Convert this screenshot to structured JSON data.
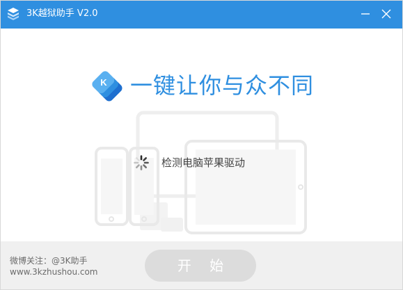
{
  "window": {
    "title": "3K越狱助手 V2.0",
    "accent_color": "#2f8fe0"
  },
  "titlebar": {
    "minimize_icon": "minimize-icon",
    "close_icon": "close-icon"
  },
  "main": {
    "logo_icon": "3k-logo-icon",
    "slogan": "一键让你与众不同",
    "status_text": "检测电脑苹果驱动",
    "spinner_icon": "loading-spinner-icon",
    "illustration": "devices-illustration"
  },
  "footer": {
    "weibo_text": "微博关注：@3K助手",
    "website_text": "www.3kzhushou.com",
    "start_button_label": "开 始"
  }
}
